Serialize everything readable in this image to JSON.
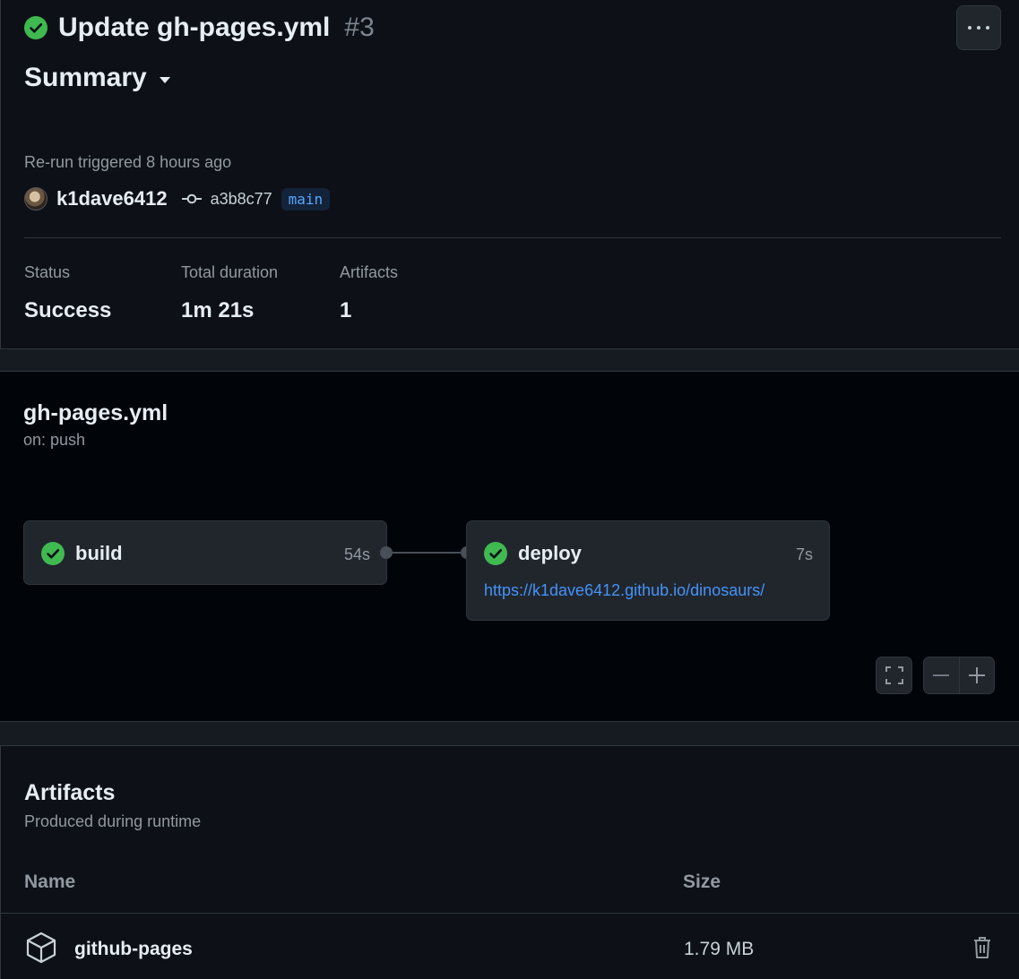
{
  "header": {
    "title": "Update gh-pages.yml",
    "run_number": "#3",
    "summary_label": "Summary",
    "trigger_text": "Re-run triggered 8 hours ago",
    "username": "k1dave6412",
    "commit_sha": "a3b8c77",
    "branch": "main"
  },
  "stats": [
    {
      "label": "Status",
      "value": "Success"
    },
    {
      "label": "Total duration",
      "value": "1m 21s"
    },
    {
      "label": "Artifacts",
      "value": "1"
    }
  ],
  "workflow": {
    "file": "gh-pages.yml",
    "trigger": "on: push",
    "jobs": [
      {
        "name": "build",
        "duration": "54s",
        "status": "success"
      },
      {
        "name": "deploy",
        "duration": "7s",
        "status": "success",
        "url": "https://k1dave6412.github.io/dinosaurs/"
      }
    ]
  },
  "artifacts": {
    "title": "Artifacts",
    "subtitle": "Produced during runtime",
    "columns": [
      "Name",
      "Size"
    ],
    "rows": [
      {
        "name": "github-pages",
        "size": "1.79 MB",
        "icon": "package-icon"
      }
    ]
  },
  "colors": {
    "success": "#3fb950",
    "link": "#4493f8",
    "background": "#0d1117",
    "border": "#30363d"
  }
}
